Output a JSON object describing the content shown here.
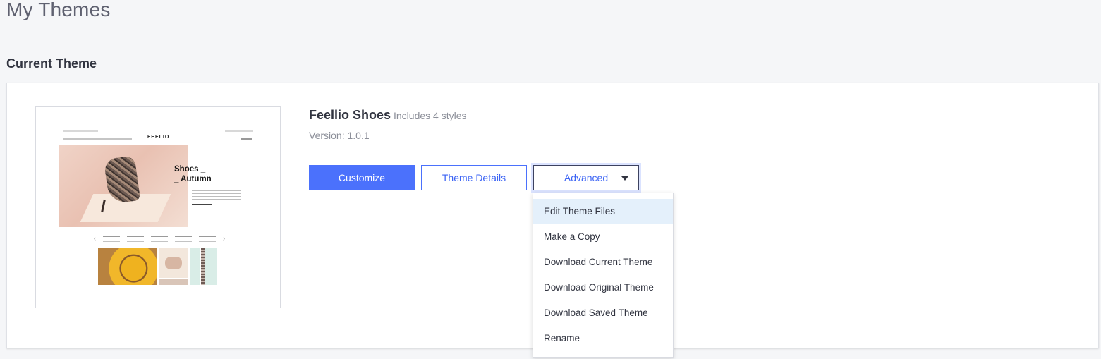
{
  "page": {
    "title": "My Themes",
    "section_title": "Current Theme"
  },
  "theme": {
    "name": "Feellio Shoes",
    "styles_note": "Includes 4 styles",
    "version": "Version: 1.0.1",
    "preview": {
      "logo": "FEELIO",
      "hero_line1": "Shoes _",
      "hero_line2": "_ Autumn"
    }
  },
  "actions": {
    "customize": "Customize",
    "theme_details": "Theme Details",
    "advanced": "Advanced"
  },
  "advanced_menu": {
    "items": [
      "Edit Theme Files",
      "Make a Copy",
      "Download Current Theme",
      "Download Original Theme",
      "Download Saved Theme",
      "Rename"
    ],
    "highlighted_index": 0
  },
  "icons": {
    "advanced_toggle": "caret-down-icon"
  },
  "colors": {
    "primary": "#4b71fc",
    "highlight": "#e4f0fb",
    "background": "#f5f6f8"
  }
}
